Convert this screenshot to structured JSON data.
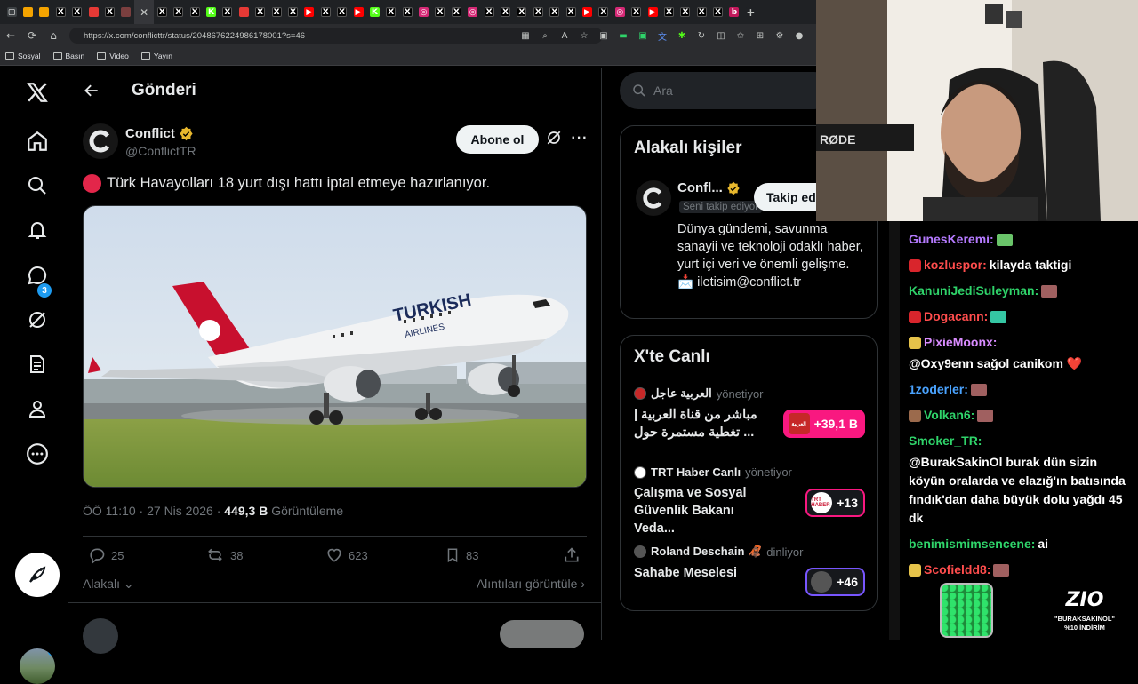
{
  "browser": {
    "tabs": [
      {
        "icon": "tab-icon",
        "color": "#3c4043",
        "glyph": "▢"
      },
      {
        "icon": "tab-icon",
        "color": "#f4a300",
        "glyph": ""
      },
      {
        "icon": "tab-icon",
        "color": "#f4a300",
        "glyph": ""
      },
      {
        "icon": "x-tab-icon",
        "color": "#000000",
        "glyph": "X"
      },
      {
        "icon": "x-tab-icon",
        "color": "#000000",
        "glyph": "X"
      },
      {
        "icon": "tab-icon",
        "color": "#e53935",
        "glyph": ""
      },
      {
        "icon": "x-tab-icon",
        "color": "#000000",
        "glyph": "X"
      },
      {
        "icon": "tab-icon",
        "color": "#7b3f3f",
        "glyph": ""
      },
      {
        "icon": "close-tab-icon",
        "color": "#35363a",
        "glyph": "✕",
        "active": true
      },
      {
        "icon": "x-tab-icon",
        "color": "#000000",
        "glyph": "X"
      },
      {
        "icon": "x-tab-icon",
        "color": "#000000",
        "glyph": "X"
      },
      {
        "icon": "x-tab-icon",
        "color": "#000000",
        "glyph": "X"
      },
      {
        "icon": "kick-tab-icon",
        "color": "#53fc18",
        "glyph": "K"
      },
      {
        "icon": "x-tab-icon",
        "color": "#000000",
        "glyph": "X"
      },
      {
        "icon": "tab-icon",
        "color": "#e53935",
        "glyph": ""
      },
      {
        "icon": "x-tab-icon",
        "color": "#000000",
        "glyph": "X"
      },
      {
        "icon": "x-tab-icon",
        "color": "#000000",
        "glyph": "X"
      },
      {
        "icon": "x-tab-icon",
        "color": "#000000",
        "glyph": "X"
      },
      {
        "icon": "youtube-tab-icon",
        "color": "#ff0000",
        "glyph": "▶"
      },
      {
        "icon": "x-tab-icon",
        "color": "#000000",
        "glyph": "X"
      },
      {
        "icon": "x-tab-icon",
        "color": "#000000",
        "glyph": "X"
      },
      {
        "icon": "youtube-tab-icon",
        "color": "#ff0000",
        "glyph": "▶"
      },
      {
        "icon": "kick-tab-icon",
        "color": "#53fc18",
        "glyph": "K"
      },
      {
        "icon": "x-tab-icon",
        "color": "#000000",
        "glyph": "X"
      },
      {
        "icon": "x-tab-icon",
        "color": "#000000",
        "glyph": "X"
      },
      {
        "icon": "instagram-tab-icon",
        "color": "#d62976",
        "glyph": "◎"
      },
      {
        "icon": "x-tab-icon",
        "color": "#000000",
        "glyph": "X"
      },
      {
        "icon": "x-tab-icon",
        "color": "#000000",
        "glyph": "X"
      },
      {
        "icon": "instagram-tab-icon",
        "color": "#d62976",
        "glyph": "◎"
      },
      {
        "icon": "x-tab-icon",
        "color": "#000000",
        "glyph": "X"
      },
      {
        "icon": "x-tab-icon",
        "color": "#000000",
        "glyph": "X"
      },
      {
        "icon": "x-tab-icon",
        "color": "#000000",
        "glyph": "X"
      },
      {
        "icon": "x-tab-icon",
        "color": "#000000",
        "glyph": "X"
      },
      {
        "icon": "x-tab-icon",
        "color": "#000000",
        "glyph": "X"
      },
      {
        "icon": "x-tab-icon",
        "color": "#000000",
        "glyph": "X"
      },
      {
        "icon": "youtube-tab-icon",
        "color": "#ff0000",
        "glyph": "▶"
      },
      {
        "icon": "x-tab-icon",
        "color": "#000000",
        "glyph": "X"
      },
      {
        "icon": "instagram-tab-icon",
        "color": "#d62976",
        "glyph": "◎"
      },
      {
        "icon": "x-tab-icon",
        "color": "#000000",
        "glyph": "X"
      },
      {
        "icon": "youtube-tab-icon",
        "color": "#ff0000",
        "glyph": "▶"
      },
      {
        "icon": "x-tab-icon",
        "color": "#000000",
        "glyph": "X"
      },
      {
        "icon": "x-tab-icon",
        "color": "#000000",
        "glyph": "X"
      },
      {
        "icon": "x-tab-icon",
        "color": "#000000",
        "glyph": "X"
      },
      {
        "icon": "x-tab-icon",
        "color": "#000000",
        "glyph": "X"
      },
      {
        "icon": "tab-icon",
        "color": "#c2185b",
        "glyph": "b"
      },
      {
        "icon": "new-tab-icon",
        "color": "#1f2124",
        "glyph": "+"
      }
    ],
    "url": "https://x.com/conflicttr/status/2048676224986178001?s=46",
    "bookmarks": [
      "Sosyal",
      "Basın",
      "Video",
      "Yayın"
    ]
  },
  "nav": {
    "notification_count": "3"
  },
  "post": {
    "header_title": "Gönderi",
    "author_name": "Conflict",
    "author_handle": "@ConflictTR",
    "follow_label": "Abone ol",
    "text": "Türk Havayolları 18 yurt dışı hattı iptal etmeye hazırlanıyor.",
    "image": {
      "livery_text": "TURKISH",
      "livery_sub": "AIRLINES"
    },
    "time": "ÖÖ 11:10 · 27 Nis 2026 · ",
    "views": "449,3 B",
    "views_label": " Görüntüleme",
    "stats": {
      "replies": "25",
      "reposts": "38",
      "likes": "623",
      "bookmarks": "83"
    },
    "relevant_label": "Alakalı",
    "quotes_label": "Alıntıları görüntüle"
  },
  "sidebar": {
    "search_placeholder": "Ara",
    "related_title": "Alakalı kişiler",
    "related_person": {
      "name": "Confl...",
      "follows_you": "Seni takip ediyor",
      "follow_label": "Takip ed",
      "bio": "Dünya gündemi, savunma sanayii ve teknoloji odaklı haber, yurt içi veri ve önemli gelişme. 📩 iletisim@conflict.tr"
    },
    "live_title": "X'te Canlı",
    "live_items": [
      {
        "host": "العربية عاجل",
        "role": "yönetiyor",
        "desc": "مباشر من قناة العربية | تغطية مستمرة حول ...",
        "count": "+39,1 B",
        "pill_color": "#f91880",
        "img_color": "#c62828",
        "img_label": "العربية"
      },
      {
        "host": "TRT Haber Canlı",
        "role": "yönetiyor",
        "desc": "Çalışma ve Sosyal Güvenlik Bakanı Veda...",
        "count": "+13",
        "pill_color": "#f91880",
        "img_color": "#ffffff",
        "img_label": "TRT HABER"
      },
      {
        "host": "Roland Deschain 🦧",
        "role": "dinliyor",
        "desc": "Sahabe Meselesi",
        "count": "+46",
        "pill_color": "#7856ff",
        "img_color": "#555555",
        "img_label": ""
      }
    ]
  },
  "stream": {
    "mic_brand": "RØDE",
    "chat": [
      {
        "user": "GunesKeremi:",
        "color": "#b57aff",
        "text": "",
        "badge": "",
        "emote": "#6ac46a"
      },
      {
        "user": "kozluspor:",
        "color": "#ff4d4d",
        "text": "kilayda taktigi",
        "badge": "#d9252c",
        "emote": ""
      },
      {
        "user": "KanuniJediSuleyman:",
        "color": "#2fd46a",
        "text": "",
        "badge": "",
        "emote": "#a06060"
      },
      {
        "user": "Dogacann:",
        "color": "#ff4d4d",
        "text": "",
        "badge": "#d9252c",
        "emote": "#35c7a4"
      },
      {
        "user": "PixieMoonx:",
        "color": "#d98cff",
        "text": "@Oxy9enn sağol canikom ❤️",
        "badge": "#e6c34a",
        "emote": ""
      },
      {
        "user": "1zoderler:",
        "color": "#4aa3ff",
        "text": "",
        "badge": "",
        "emote": "#a06060"
      },
      {
        "user": "Volkan6:",
        "color": "#2fd46a",
        "text": "",
        "badge": "#9b6a4c",
        "emote": "#a06060"
      },
      {
        "user": "Smoker_TR:",
        "color": "#2fd46a",
        "text": "@BurakSakinOl burak dün sizin köyün oralarda ve elazığ'ın batısında fındık'dan daha büyük dolu yağdı 45 dk",
        "badge": "",
        "emote": ""
      },
      {
        "user": "benimismimsencene:",
        "color": "#2fd46a",
        "text": "ai",
        "badge": "",
        "emote": ""
      },
      {
        "user": "Scofieldd8:",
        "color": "#ff4d4d",
        "text": "",
        "badge": "#e6c34a",
        "emote": "#a06060"
      }
    ],
    "sponsor": {
      "logo": "ZIO",
      "code": "\"BURAKSAKINOL\"",
      "discount": "%10 İNDİRİM"
    }
  },
  "colors": {
    "accent": "#1d9bf0",
    "verified_gold": "#e8b82d",
    "bg": "#000000",
    "border": "#2f3336"
  }
}
